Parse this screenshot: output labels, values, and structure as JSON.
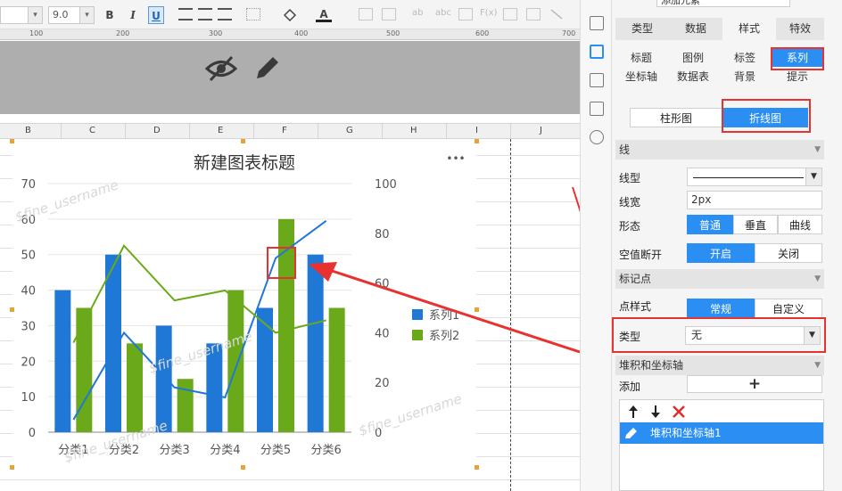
{
  "toolbar": {
    "font_size": "9.0",
    "bold_label": "B",
    "italic_label": "I",
    "underline_label": "U",
    "font_color_label": "A"
  },
  "ruler": [
    "100",
    "200",
    "300",
    "400",
    "500",
    "600",
    "700"
  ],
  "columns": [
    "B",
    "C",
    "D",
    "E",
    "F",
    "G",
    "H",
    "I",
    "J"
  ],
  "chart": {
    "title": "新建图表标题",
    "more_label": "•••"
  },
  "chart_data": {
    "type": "bar",
    "categories": [
      "分类1",
      "分类2",
      "分类3",
      "分类4",
      "分类5",
      "分类6"
    ],
    "series": [
      {
        "name": "系列1",
        "type": "bar",
        "axis": "left",
        "color": "#1f78d6",
        "values": [
          40,
          50,
          30,
          25,
          35,
          50
        ]
      },
      {
        "name": "系列2",
        "type": "bar",
        "axis": "left",
        "color": "#6aaa1a",
        "values": [
          35,
          25,
          15,
          40,
          60,
          35
        ]
      },
      {
        "name": "系列1",
        "type": "line",
        "axis": "right",
        "color": "#1f78d6",
        "values": [
          5,
          40,
          18,
          14,
          70,
          85
        ]
      },
      {
        "name": "系列2",
        "type": "line",
        "axis": "right",
        "color": "#6aaa1a",
        "values": [
          36,
          75,
          53,
          57,
          40,
          45
        ]
      }
    ],
    "y_left": {
      "ticks": [
        "0",
        "10",
        "20",
        "30",
        "40",
        "50",
        "60",
        "70"
      ],
      "range": [
        0,
        70
      ]
    },
    "y_right": {
      "ticks": [
        "0",
        "20",
        "40",
        "60",
        "80",
        "100"
      ],
      "range": [
        0,
        100
      ]
    },
    "legend": [
      "系列1",
      "系列2"
    ],
    "legend_position": "right"
  },
  "panel": {
    "header_text": "添加元素",
    "tabs": [
      "类型",
      "数据",
      "样式",
      "特效"
    ],
    "subtabs_row1": [
      "标题",
      "图例",
      "标签",
      "系列"
    ],
    "subtabs_row2": [
      "坐标轴",
      "数据表",
      "背景",
      "提示"
    ],
    "chart_types": [
      "柱形图",
      "折线图"
    ],
    "sections": {
      "line": "线",
      "marker": "标记点",
      "stack": "堆积和坐标轴"
    },
    "line_type_label": "线型",
    "line_width_label": "线宽",
    "line_width_value": "2px",
    "shape_label": "形态",
    "shape_options": [
      "普通",
      "垂直",
      "曲线"
    ],
    "null_break_label": "空值断开",
    "null_break_options": [
      "开启",
      "关闭"
    ],
    "marker_style_label": "点样式",
    "marker_style_options": [
      "常规",
      "自定义"
    ],
    "type_label": "类型",
    "type_value": "无",
    "add_label": "添加",
    "add_button": "+",
    "stack_item": "堆积和坐标轴1"
  },
  "watermark": "$fine_username",
  "colors": {
    "accent": "#2b8ef3",
    "highlight": "#e8322f",
    "bar_blue": "#1f78d6",
    "bar_green": "#6aaa1a"
  }
}
